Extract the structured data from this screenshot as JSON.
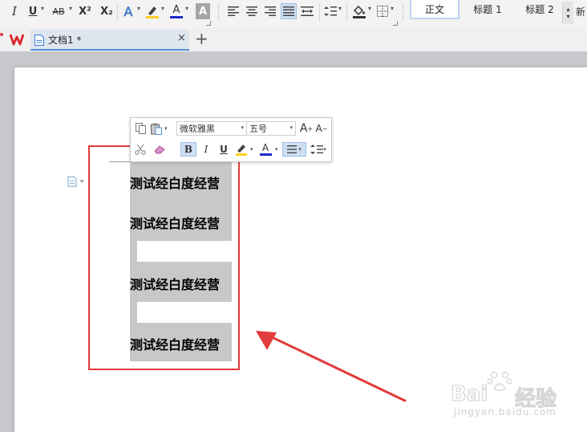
{
  "ribbon": {
    "italic": "I",
    "underline": "U",
    "strike": "AB",
    "superscript": "X²",
    "subscript": "X₂",
    "text_effect": "A",
    "font_color": "A",
    "char_shade": "A",
    "styles": [
      "正文",
      "标题 1",
      "标题 2"
    ],
    "more_style": "新"
  },
  "tabs": [
    {
      "label": "文档1 *"
    }
  ],
  "mini_toolbar": {
    "font_name": "微软雅黑",
    "font_size": "五号",
    "grow": "A",
    "shrink": "A",
    "bold": "B",
    "italic": "I",
    "underline": "U",
    "font_color": "A"
  },
  "document": {
    "lines": [
      "测试经白度经营",
      "测试经白度经营",
      "测试经白度经营",
      "测试经白度经营"
    ]
  },
  "watermark": {
    "brand": "Bai",
    "brand2": "经验",
    "url": "jingyan.baidu.com"
  },
  "colors": {
    "accent": "#4d8fd6",
    "highlight": "#e23b3b",
    "shade": "#c8c8c8"
  }
}
